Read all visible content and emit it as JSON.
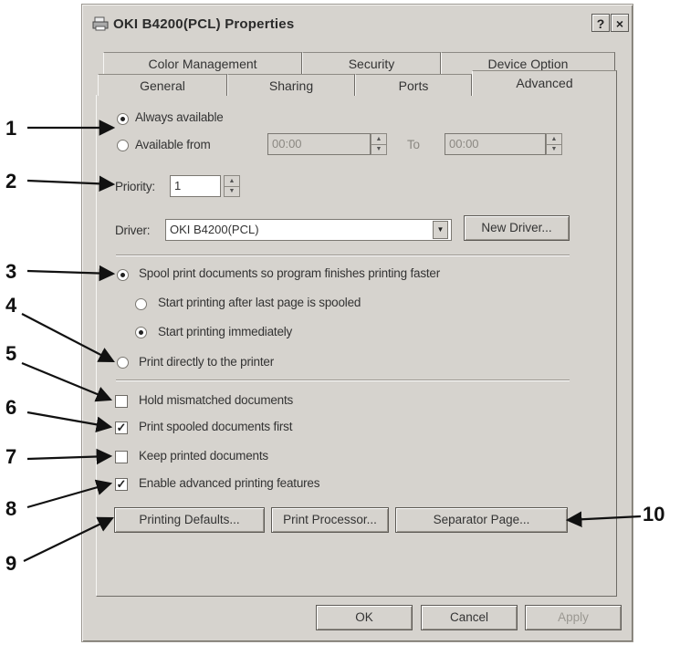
{
  "window": {
    "title": "OKI B4200(PCL) Properties",
    "help_button": "?",
    "close_button": "×"
  },
  "tabs_back": [
    "Color Management",
    "Security",
    "Device Option"
  ],
  "tabs_front": [
    "General",
    "Sharing",
    "Ports",
    "Advanced"
  ],
  "availability": {
    "always_label": "Always available",
    "from_label": "Available from",
    "from_time": "00:00",
    "to_label": "To",
    "to_time": "00:00"
  },
  "priority": {
    "label": "Priority:",
    "value": "1"
  },
  "driver": {
    "label": "Driver:",
    "value": "OKI B4200(PCL)",
    "new_driver_button": "New Driver..."
  },
  "spool": {
    "spool_label": "Spool print documents so program finishes printing faster",
    "after_last_page": "Start printing after last page is spooled",
    "immediately": "Start printing immediately",
    "direct_label": "Print directly to the printer"
  },
  "options": {
    "hold_mismatched": "Hold mismatched documents",
    "spooled_first": "Print spooled documents first",
    "keep_printed": "Keep printed documents",
    "advanced_features": "Enable advanced printing features"
  },
  "buttons": {
    "printing_defaults": "Printing Defaults...",
    "print_processor": "Print Processor...",
    "separator_page": "Separator Page...",
    "ok": "OK",
    "cancel": "Cancel",
    "apply": "Apply"
  },
  "callouts": [
    "1",
    "2",
    "3",
    "4",
    "5",
    "6",
    "7",
    "8",
    "9",
    "10"
  ],
  "colors": {
    "dialog_face": "#d6d3ce",
    "text": "#333333",
    "callout_line": "#111111"
  }
}
